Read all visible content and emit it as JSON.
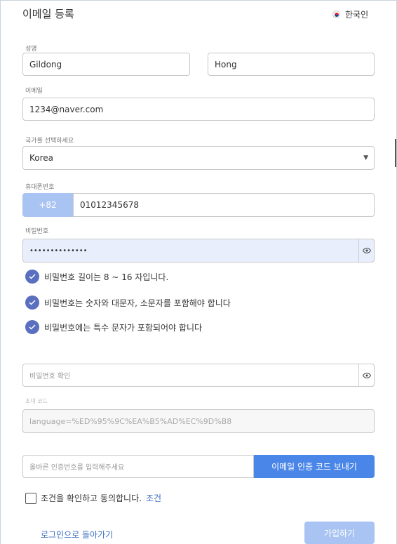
{
  "header": {
    "title": "이메일 등록",
    "language": "한국인"
  },
  "form": {
    "name_label": "성명",
    "first_name": "Gildong",
    "last_name": "Hong",
    "email_label": "이메일",
    "email": "1234@naver.com",
    "country_label": "국가를 선택하세요",
    "country": "Korea",
    "phone_label": "휴대폰번호",
    "phone_prefix": "+82",
    "phone": "01012345678",
    "password_label": "비밀번호",
    "password": "••••••••••••••",
    "rules": [
      "비밀번호 길이는 8 ~ 16 자입니다.",
      "비밀번호는 숫자와 대문자, 소문자를 포함해야 합니다",
      "비밀번호에는 특수 문자가 포함되어야 합니다"
    ],
    "confirm_placeholder": "비밀번호 확인",
    "invite_label": "초대 코드",
    "invite_value": "language=%ED%95%9C%EA%B5%AD%EC%9D%B8",
    "code_placeholder": "올바른 인증번호를 입력해주세요",
    "send_code_label": "이메일 인증 코드 보내기",
    "terms_text": "조건을 확인하고 동의합니다.",
    "terms_link": "조건",
    "back_to_login": "로그인으로 돌아가기",
    "signup": "가입하기"
  },
  "colors": {
    "accent": "#4a86e8",
    "disabled_accent": "#a9c4f2",
    "check": "#5a6fbf",
    "link": "#3f6fc4"
  }
}
